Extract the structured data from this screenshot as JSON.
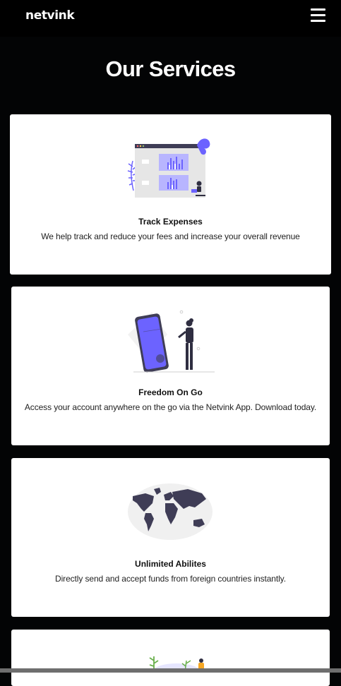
{
  "navbar": {
    "brand": "netvink",
    "menu_icon": "hamburger-menu-icon"
  },
  "page": {
    "title": "Our Services"
  },
  "services": [
    {
      "title": "Track Expenses",
      "description": "We help track and reduce your fees and increase your overall revenue",
      "illustration": "dashboard-analytics-illustration"
    },
    {
      "title": "Freedom On Go",
      "description": "Access your account anywhere on the go via the Netvink App. Download today.",
      "illustration": "mobile-phone-illustration"
    },
    {
      "title": "Unlimited Abilites",
      "description": "Directly send and accept funds from foreign countries instantly.",
      "illustration": "world-map-illustration"
    },
    {
      "title": "",
      "description": "",
      "illustration": "plants-person-illustration"
    }
  ],
  "colors": {
    "background": "#030405",
    "card": "#ffffff",
    "accent": "#6c63ff",
    "dark": "#2f2e41"
  }
}
